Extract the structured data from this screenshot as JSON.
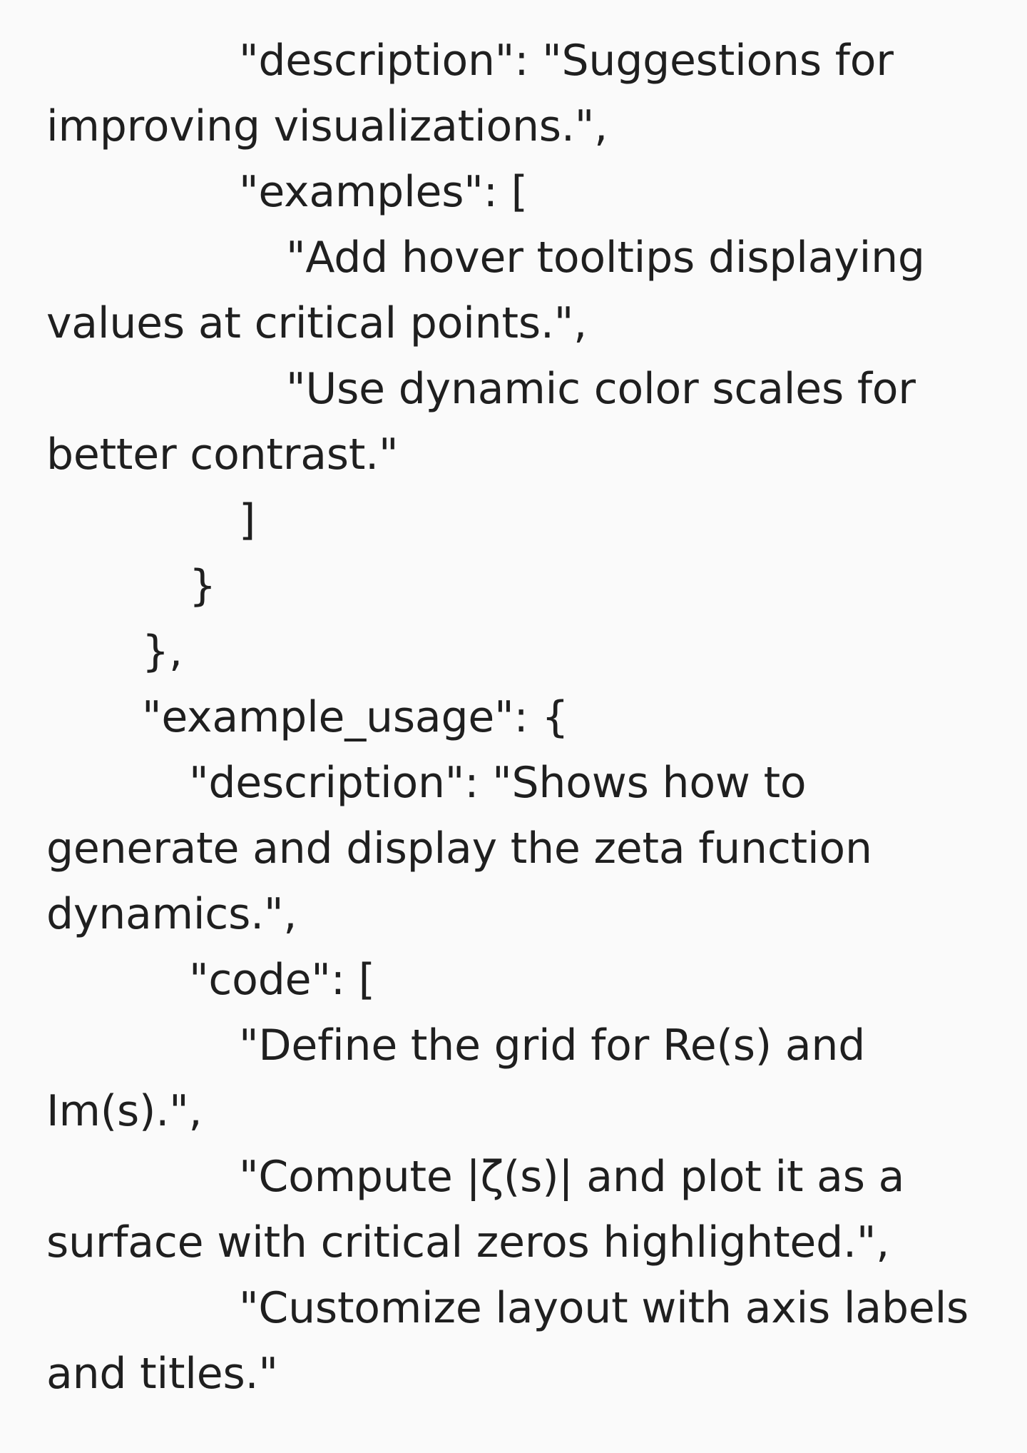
{
  "lines": [
    "\"description\": \"Suggestions for",
    "improving visualizations.\",",
    "\"examples\": [",
    "\"Add hover tooltips displaying",
    "values at critical points.\",",
    "\"Use dynamic color scales for",
    "better contrast.\"",
    "]",
    "}",
    "},",
    "\"example_usage\": {",
    "\"description\": \"Shows how to",
    "generate and display the zeta function",
    "dynamics.\",",
    "\"code\": [",
    "\"Define the grid for Re(s) and",
    "Im(s).\",",
    "\"Compute |ζ(s)| and plot it as a",
    "surface with critical zeros highlighted.\",",
    "\"Customize layout with axis labels",
    "and titles.\""
  ]
}
